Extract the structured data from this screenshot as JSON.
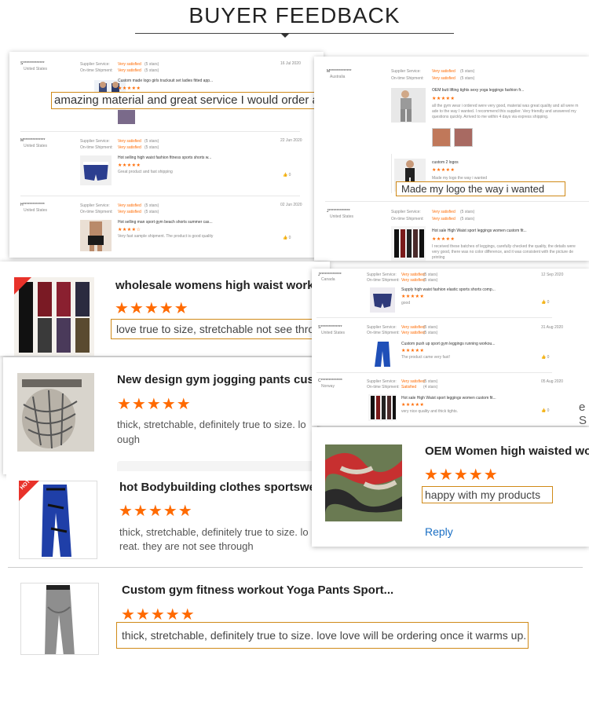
{
  "header": {
    "title": "BUYER FEEDBACK"
  },
  "colors": {
    "accent": "#ff6a00",
    "highlight_border": "#d08a18",
    "link": "#1a6fc4"
  },
  "labels": {
    "supplier": "Supplier Service:",
    "shipment": "On-time Shipment:"
  },
  "shot1": {
    "reviews": [
      {
        "user": "S**************",
        "country": "United States",
        "s1": "Very satisfied",
        "n1": "(5 stars)",
        "s2": "Very satisfied",
        "n2": "(5 stars)",
        "date": "16 Jul 2020",
        "product": "Custom made logo girls tracksuit set ladies fitted app...",
        "text": "",
        "likes": ""
      },
      {
        "user": "M**************",
        "country": "United States",
        "s1": "Very satisfied",
        "n1": "(5 stars)",
        "s2": "Very satisfied",
        "n2": "(5 stars)",
        "date": "22 Jun 2020",
        "product": "Hot selling high waist fashion fitness sports shorts w...",
        "text": "Great product and fast shipping",
        "likes": "0"
      },
      {
        "user": "H**************",
        "country": "United States",
        "s1": "Very satisfied",
        "n1": "(5 stars)",
        "s2": "Very satisfied",
        "n2": "(5 stars)",
        "date": "02 Jun 2020",
        "product": "Hot selling man sport gym beach shorts summer cas...",
        "text": "Very fast sample shipment. The product is good quality",
        "likes": "0"
      }
    ],
    "highlight": "amazing material and great service I would order again!"
  },
  "shot2": {
    "reviews": [
      {
        "user": "M**************",
        "country": "Australia",
        "s1": "Very satisfied",
        "n1": "(5 stars)",
        "s2": "Very satisfied",
        "n2": "(5 stars)",
        "product": "OEM butt lifting tights sexy yoga leggings fashion fr...",
        "text": "all the gym wear i ordered were very good, material was great quality and all were m",
        "text2": "ade to the way I wanted. I recommend this supplier. Very friendly and answered my",
        "text3": "questions quickly. Arrived to me within 4 days via express shipping."
      },
      {
        "product": "custom 2 logos",
        "text": "Made my logo the way i wanted"
      },
      {
        "user": "J**************",
        "country": "United States",
        "s1": "Very satisfied",
        "n1": "(5 stars)",
        "s2": "Very satisfied",
        "n2": "(5 stars)",
        "product": "Hot sale High Waist sport leggings women custom fit...",
        "text": "I received these batches of leggings, carefully checked the quality, the details were",
        "text2": "very good, there was no color difference, and it was consistent with the picture de",
        "text3": "printing"
      }
    ],
    "highlight": "Made my logo the way i wanted"
  },
  "shot3": {
    "product": "wholesale womens high waist worko",
    "highlight": "love true to size, stretchable not see throu"
  },
  "shot4": {
    "reviews": [
      {
        "user": "J**************",
        "country": "Canada",
        "s1": "Very satisfied",
        "n1": "(5 stars)",
        "s2": "Very satisfied",
        "n2": "(5 stars)",
        "date": "12 Sep 2020",
        "product": "Supply high waist fashion elastic sports shorts comp...",
        "text": "good",
        "likes": "0"
      },
      {
        "user": "S**************",
        "country": "United States",
        "s1": "Very satisfied",
        "n1": "(5 stars)",
        "s2": "Very satisfied",
        "n2": "(5 stars)",
        "date": "31 Aug 2020",
        "product": "Custom push up sport gym leggings running workou...",
        "text": "The product came very fast!",
        "likes": "0"
      },
      {
        "user": "C**************",
        "country": "Norway",
        "s1": "Very satisfied",
        "n1": "(5 stars)",
        "s2": "Satisfied",
        "n2": "(4 stars)",
        "date": "05 Aug 2020",
        "product": "Hot sale High Waist sport leggings women custom fit...",
        "text": "very nice quality and thick tights.",
        "likes": "0"
      }
    ],
    "edge_letter": "e S"
  },
  "shot5": {
    "product": "New design gym jogging pants cust",
    "text": "thick, stretchable, definitely true to size. lo",
    "text2": "ough"
  },
  "shot6": {
    "product": "OEM Women high waisted wo",
    "highlight": "happy with my products",
    "reply": "Reply"
  },
  "shot7": {
    "hot": "HOT",
    "product": "hot Bodybuilding clothes sportswea",
    "text": "thick, stretchable, definitely true to size. lo",
    "text2": "reat. they are not see through"
  },
  "shot8": {
    "product": "Custom gym fitness workout Yoga Pants Sport...",
    "highlight": "thick, stretchable, definitely true to size. love love will be ordering once it warms up."
  },
  "stars": "★★★★★",
  "stars_four": "★★★★☆"
}
